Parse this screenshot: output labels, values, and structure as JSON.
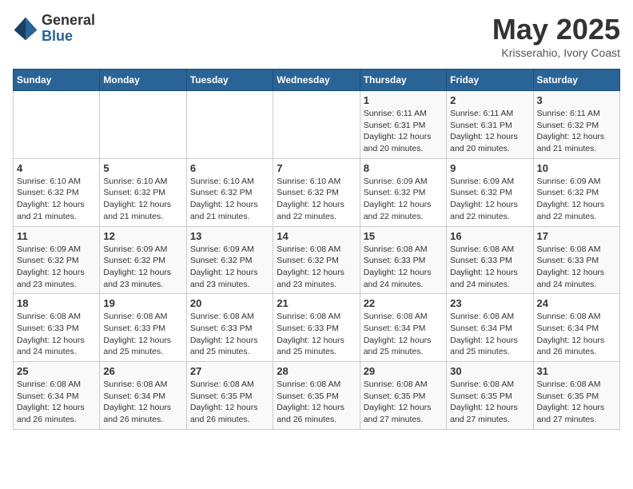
{
  "header": {
    "logo_general": "General",
    "logo_blue": "Blue",
    "title": "May 2025",
    "subtitle": "Krisserahio, Ivory Coast"
  },
  "calendar": {
    "weekdays": [
      "Sunday",
      "Monday",
      "Tuesday",
      "Wednesday",
      "Thursday",
      "Friday",
      "Saturday"
    ],
    "weeks": [
      [
        {
          "day": "",
          "info": ""
        },
        {
          "day": "",
          "info": ""
        },
        {
          "day": "",
          "info": ""
        },
        {
          "day": "",
          "info": ""
        },
        {
          "day": "1",
          "info": "Sunrise: 6:11 AM\nSunset: 6:31 PM\nDaylight: 12 hours\nand 20 minutes."
        },
        {
          "day": "2",
          "info": "Sunrise: 6:11 AM\nSunset: 6:31 PM\nDaylight: 12 hours\nand 20 minutes."
        },
        {
          "day": "3",
          "info": "Sunrise: 6:11 AM\nSunset: 6:32 PM\nDaylight: 12 hours\nand 21 minutes."
        }
      ],
      [
        {
          "day": "4",
          "info": "Sunrise: 6:10 AM\nSunset: 6:32 PM\nDaylight: 12 hours\nand 21 minutes."
        },
        {
          "day": "5",
          "info": "Sunrise: 6:10 AM\nSunset: 6:32 PM\nDaylight: 12 hours\nand 21 minutes."
        },
        {
          "day": "6",
          "info": "Sunrise: 6:10 AM\nSunset: 6:32 PM\nDaylight: 12 hours\nand 21 minutes."
        },
        {
          "day": "7",
          "info": "Sunrise: 6:10 AM\nSunset: 6:32 PM\nDaylight: 12 hours\nand 22 minutes."
        },
        {
          "day": "8",
          "info": "Sunrise: 6:09 AM\nSunset: 6:32 PM\nDaylight: 12 hours\nand 22 minutes."
        },
        {
          "day": "9",
          "info": "Sunrise: 6:09 AM\nSunset: 6:32 PM\nDaylight: 12 hours\nand 22 minutes."
        },
        {
          "day": "10",
          "info": "Sunrise: 6:09 AM\nSunset: 6:32 PM\nDaylight: 12 hours\nand 22 minutes."
        }
      ],
      [
        {
          "day": "11",
          "info": "Sunrise: 6:09 AM\nSunset: 6:32 PM\nDaylight: 12 hours\nand 23 minutes."
        },
        {
          "day": "12",
          "info": "Sunrise: 6:09 AM\nSunset: 6:32 PM\nDaylight: 12 hours\nand 23 minutes."
        },
        {
          "day": "13",
          "info": "Sunrise: 6:09 AM\nSunset: 6:32 PM\nDaylight: 12 hours\nand 23 minutes."
        },
        {
          "day": "14",
          "info": "Sunrise: 6:08 AM\nSunset: 6:32 PM\nDaylight: 12 hours\nand 23 minutes."
        },
        {
          "day": "15",
          "info": "Sunrise: 6:08 AM\nSunset: 6:33 PM\nDaylight: 12 hours\nand 24 minutes."
        },
        {
          "day": "16",
          "info": "Sunrise: 6:08 AM\nSunset: 6:33 PM\nDaylight: 12 hours\nand 24 minutes."
        },
        {
          "day": "17",
          "info": "Sunrise: 6:08 AM\nSunset: 6:33 PM\nDaylight: 12 hours\nand 24 minutes."
        }
      ],
      [
        {
          "day": "18",
          "info": "Sunrise: 6:08 AM\nSunset: 6:33 PM\nDaylight: 12 hours\nand 24 minutes."
        },
        {
          "day": "19",
          "info": "Sunrise: 6:08 AM\nSunset: 6:33 PM\nDaylight: 12 hours\nand 25 minutes."
        },
        {
          "day": "20",
          "info": "Sunrise: 6:08 AM\nSunset: 6:33 PM\nDaylight: 12 hours\nand 25 minutes."
        },
        {
          "day": "21",
          "info": "Sunrise: 6:08 AM\nSunset: 6:33 PM\nDaylight: 12 hours\nand 25 minutes."
        },
        {
          "day": "22",
          "info": "Sunrise: 6:08 AM\nSunset: 6:34 PM\nDaylight: 12 hours\nand 25 minutes."
        },
        {
          "day": "23",
          "info": "Sunrise: 6:08 AM\nSunset: 6:34 PM\nDaylight: 12 hours\nand 25 minutes."
        },
        {
          "day": "24",
          "info": "Sunrise: 6:08 AM\nSunset: 6:34 PM\nDaylight: 12 hours\nand 26 minutes."
        }
      ],
      [
        {
          "day": "25",
          "info": "Sunrise: 6:08 AM\nSunset: 6:34 PM\nDaylight: 12 hours\nand 26 minutes."
        },
        {
          "day": "26",
          "info": "Sunrise: 6:08 AM\nSunset: 6:34 PM\nDaylight: 12 hours\nand 26 minutes."
        },
        {
          "day": "27",
          "info": "Sunrise: 6:08 AM\nSunset: 6:35 PM\nDaylight: 12 hours\nand 26 minutes."
        },
        {
          "day": "28",
          "info": "Sunrise: 6:08 AM\nSunset: 6:35 PM\nDaylight: 12 hours\nand 26 minutes."
        },
        {
          "day": "29",
          "info": "Sunrise: 6:08 AM\nSunset: 6:35 PM\nDaylight: 12 hours\nand 27 minutes."
        },
        {
          "day": "30",
          "info": "Sunrise: 6:08 AM\nSunset: 6:35 PM\nDaylight: 12 hours\nand 27 minutes."
        },
        {
          "day": "31",
          "info": "Sunrise: 6:08 AM\nSunset: 6:35 PM\nDaylight: 12 hours\nand 27 minutes."
        }
      ]
    ]
  }
}
